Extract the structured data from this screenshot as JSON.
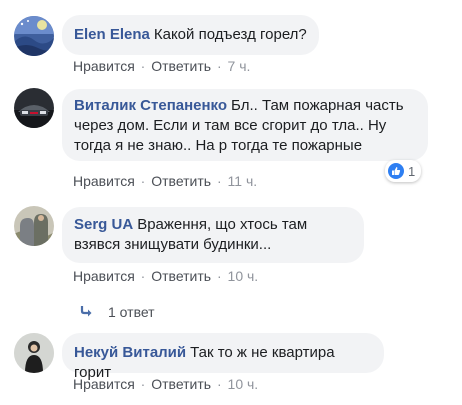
{
  "comments": [
    {
      "author": "Elen Elena",
      "text": "Какой подъезд горел?",
      "like_label": "Нравится",
      "reply_label": "Ответить",
      "time": "7 ч."
    },
    {
      "author": "Виталик Степаненко",
      "text": "Бл.. Там пожарная часть через дом. Если и там все сгорит до тла.. Ну тогда я не знаю.. На  р тогда те пожарные",
      "like_label": "Нравится",
      "reply_label": "Ответить",
      "time": "11 ч.",
      "reaction_count": "1",
      "reaction_icon": "thumbs-up-icon"
    },
    {
      "author": "Serg UA",
      "text": "Враження, що хтось там взявся знищувати будинки...",
      "like_label": "Нравится",
      "reply_label": "Ответить",
      "time": "10 ч.",
      "replies_label": "1 ответ"
    },
    {
      "author": "Некуй Виталий",
      "text": "Так то ж не квартира горит",
      "like_label": "Нравится",
      "reply_label": "Ответить",
      "time": "10 ч."
    }
  ],
  "separator": "·",
  "colors": {
    "author": "#385898",
    "bubble_bg": "#f2f3f5",
    "meta": "#616770",
    "like_blue": "#2e7ff2",
    "reply_arrow": "#4b6ea9"
  }
}
